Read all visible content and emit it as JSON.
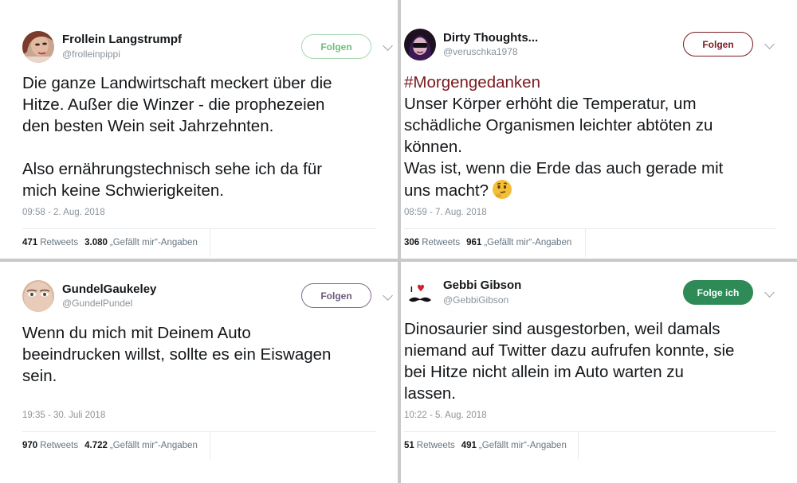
{
  "tweets": [
    {
      "name": "Frollein Langstrumpf",
      "handle": "@frolleinpippi",
      "follow_label": "Folgen",
      "text_lines": [
        "Die ganze Landwirtschaft meckert über die",
        "Hitze. Außer die Winzer - die prophezeien",
        "den besten Wein seit Jahrzehnten.",
        "",
        "Also ernährungstechnisch sehe ich da für",
        "mich keine Schwierigkeiten."
      ],
      "time": "09:58 - 2. Aug. 2018",
      "retweets": "471",
      "retweets_label": "Retweets",
      "likes": "3.080",
      "likes_label": "„Gefällt mir“-Angaben"
    },
    {
      "name": "Dirty Thoughts...",
      "handle": "@veruschka1978",
      "follow_label": "Folgen",
      "hashtag": "#Morgengedanken",
      "text_lines": [
        "Unser Körper erhöht die Temperatur, um",
        "schädliche Organismen leichter abtöten zu",
        "können.",
        "Was ist, wenn die Erde das auch gerade mit",
        "uns macht?"
      ],
      "time": "08:59 - 7. Aug. 2018",
      "retweets": "306",
      "retweets_label": "Retweets",
      "likes": "961",
      "likes_label": "„Gefällt mir“-Angaben"
    },
    {
      "name": "GundelGaukeley",
      "handle": "@GundelPundel",
      "follow_label": "Folgen",
      "text_lines": [
        "Wenn du mich mit Deinem Auto",
        "beeindrucken willst, sollte es ein Eiswagen",
        "sein."
      ],
      "time": "19:35 - 30. Juli 2018",
      "retweets": "970",
      "retweets_label": "Retweets",
      "likes": "4.722",
      "likes_label": "„Gefällt mir“-Angaben"
    },
    {
      "name": "Gebbi Gibson",
      "handle": "@GebbiGibson",
      "follow_label": "Folge ich",
      "text_lines": [
        "Dinosaurier sind ausgestorben, weil damals",
        "niemand auf Twitter dazu aufrufen konnte, sie",
        "bei Hitze nicht allein im Auto warten zu",
        "lassen."
      ],
      "time": "10:22 - 5. Aug. 2018",
      "retweets": "51",
      "retweets_label": "Retweets",
      "likes": "491",
      "likes_label": "„Gefällt mir“-Angaben"
    }
  ],
  "colors": {
    "follow_green": "#6cbf7a",
    "follow_dark_red": "#7a1a1f",
    "follow_purple": "#7e6b8c",
    "following_bg": "#2e8b57",
    "hashtag": "#7a1a1f"
  },
  "icons": {
    "thinking_emoji": "thinking-face-icon",
    "chevron": "chevron-down-icon"
  }
}
